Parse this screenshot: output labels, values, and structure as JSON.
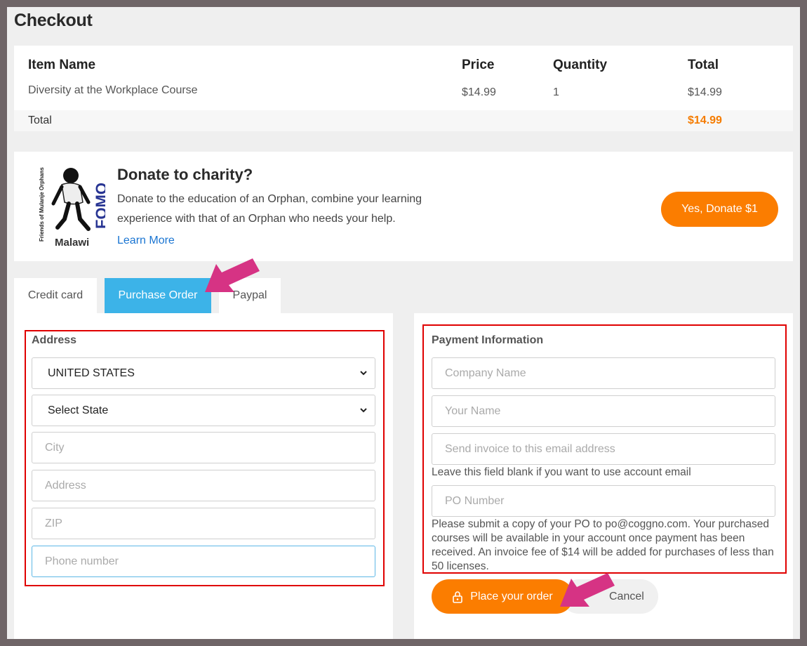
{
  "page": {
    "title": "Checkout"
  },
  "order": {
    "headers": {
      "item": "Item Name",
      "price": "Price",
      "quantity": "Quantity",
      "total": "Total"
    },
    "rows": [
      {
        "item": "Diversity at the Workplace Course",
        "price": "$14.99",
        "quantity": "1",
        "total": "$14.99"
      }
    ],
    "total_label": "Total",
    "total_value": "$14.99"
  },
  "donate": {
    "logo_text": "Friends of Mulanje Orphans",
    "logo_acronym": "FOMO",
    "logo_country": "Malawi",
    "title": "Donate to charity?",
    "text": "Donate to the education of an Orphan, combine your learning experience with that of an Orphan who needs your help.",
    "learn_more": "Learn More",
    "button": "Yes, Donate $1"
  },
  "tabs": [
    {
      "label": "Credit card",
      "active": false
    },
    {
      "label": "Purchase Order",
      "active": true
    },
    {
      "label": "Paypal",
      "active": false
    }
  ],
  "address": {
    "label": "Address",
    "country": "UNITED STATES",
    "state": "Select State",
    "city_placeholder": "City",
    "address_placeholder": "Address",
    "zip_placeholder": "ZIP",
    "phone_placeholder": "Phone number"
  },
  "payment": {
    "label": "Payment Information",
    "company_placeholder": "Company Name",
    "name_placeholder": "Your Name",
    "email_placeholder": "Send invoice to this email address",
    "email_hint": "Leave this field blank if you want to use account email",
    "po_placeholder": "PO Number",
    "po_note": "Please submit a copy of your PO to po@coggno.com. Your purchased courses will be available in your account once payment has been received. An invoice fee of $14 will be added for purchases of less than 50 licenses."
  },
  "actions": {
    "place_order": "Place your order",
    "cancel": "Cancel"
  },
  "colors": {
    "accent": "#fb7d00",
    "tab_active": "#3cb3e8",
    "highlight": "#e00000",
    "arrow": "#d63384",
    "link": "#1a75d2"
  }
}
